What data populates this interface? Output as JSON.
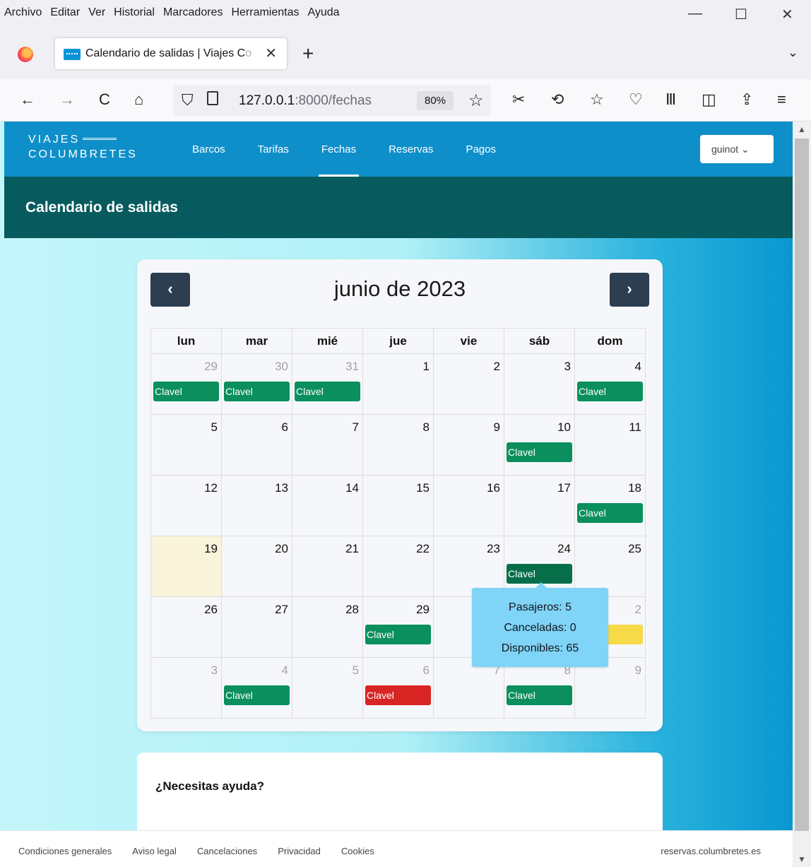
{
  "menubar": {
    "items": [
      "Archivo",
      "Editar",
      "Ver",
      "Historial",
      "Marcadores",
      "Herramientas",
      "Ayuda"
    ],
    "window_controls": [
      "—",
      "☐",
      "✕"
    ]
  },
  "tab": {
    "title": "Calendario de salidas | Viajes C",
    "title_fade": "o",
    "close": "✕",
    "new_tab": "+",
    "list_all": "⌄"
  },
  "navbar": {
    "back": "←",
    "forward": "→",
    "reload": "C",
    "home": "⌂",
    "url_host": "127.0.0.1",
    "url_rest": ":8000/fechas",
    "zoom": "80%",
    "bookmark_star": "☆",
    "toolbar_icons": [
      "screenshot-icon",
      "history-icon",
      "extension-star-icon",
      "pocket-icon",
      "library-icon",
      "sidebar-icon",
      "share-icon",
      "menu-icon"
    ],
    "toolbar_glyphs": [
      "✂",
      "⟲",
      "☆",
      "♡",
      "Ⅲ",
      "◫",
      "⇪",
      "≡"
    ]
  },
  "site": {
    "logo_line1": "VIAJES",
    "logo_line2": "COLUMBRETES",
    "nav": [
      "Barcos",
      "Tarifas",
      "Fechas",
      "Reservas",
      "Pagos"
    ],
    "active_nav": "Fechas",
    "user": "guinot ⌄",
    "page_title": "Calendario de salidas"
  },
  "calendar": {
    "prev": "‹",
    "next": "›",
    "month_title": "junio de 2023",
    "weekdays": [
      "lun",
      "mar",
      "mié",
      "jue",
      "vie",
      "sáb",
      "dom"
    ],
    "weeks": [
      [
        {
          "day": "29",
          "other": true,
          "event": "Clavel",
          "status": "green"
        },
        {
          "day": "30",
          "other": true,
          "event": "Clavel",
          "status": "green"
        },
        {
          "day": "31",
          "other": true,
          "event": "Clavel",
          "status": "green"
        },
        {
          "day": "1",
          "other": false,
          "event": "",
          "status": ""
        },
        {
          "day": "2",
          "other": false,
          "event": "",
          "status": ""
        },
        {
          "day": "3",
          "other": false,
          "event": "",
          "status": ""
        },
        {
          "day": "4",
          "other": false,
          "event": "Clavel",
          "status": "green"
        }
      ],
      [
        {
          "day": "5",
          "other": false,
          "event": "",
          "status": ""
        },
        {
          "day": "6",
          "other": false,
          "event": "",
          "status": ""
        },
        {
          "day": "7",
          "other": false,
          "event": "",
          "status": ""
        },
        {
          "day": "8",
          "other": false,
          "event": "",
          "status": ""
        },
        {
          "day": "9",
          "other": false,
          "event": "",
          "status": ""
        },
        {
          "day": "10",
          "other": false,
          "event": "Clavel",
          "status": "green"
        },
        {
          "day": "11",
          "other": false,
          "event": "",
          "status": ""
        }
      ],
      [
        {
          "day": "12",
          "other": false,
          "event": "",
          "status": ""
        },
        {
          "day": "13",
          "other": false,
          "event": "",
          "status": ""
        },
        {
          "day": "14",
          "other": false,
          "event": "",
          "status": ""
        },
        {
          "day": "15",
          "other": false,
          "event": "",
          "status": ""
        },
        {
          "day": "16",
          "other": false,
          "event": "",
          "status": ""
        },
        {
          "day": "17",
          "other": false,
          "event": "",
          "status": ""
        },
        {
          "day": "18",
          "other": false,
          "event": "Clavel",
          "status": "green"
        }
      ],
      [
        {
          "day": "19",
          "other": false,
          "today": true,
          "event": "",
          "status": ""
        },
        {
          "day": "20",
          "other": false,
          "event": "",
          "status": ""
        },
        {
          "day": "21",
          "other": false,
          "event": "",
          "status": ""
        },
        {
          "day": "22",
          "other": false,
          "event": "",
          "status": ""
        },
        {
          "day": "23",
          "other": false,
          "event": "",
          "status": ""
        },
        {
          "day": "24",
          "other": false,
          "event": "Clavel",
          "status": "darkgreen"
        },
        {
          "day": "25",
          "other": false,
          "event": "",
          "status": ""
        }
      ],
      [
        {
          "day": "26",
          "other": false,
          "event": "",
          "status": ""
        },
        {
          "day": "27",
          "other": false,
          "event": "",
          "status": ""
        },
        {
          "day": "28",
          "other": false,
          "event": "",
          "status": ""
        },
        {
          "day": "29",
          "other": false,
          "event": "Clavel",
          "status": "green"
        },
        {
          "day": "",
          "other": false,
          "event": "",
          "status": ""
        },
        {
          "day": "",
          "other": false,
          "event": "",
          "status": ""
        },
        {
          "day": "2",
          "other": true,
          "event": "l",
          "status": "yellow"
        }
      ],
      [
        {
          "day": "3",
          "other": true,
          "event": "",
          "status": ""
        },
        {
          "day": "4",
          "other": true,
          "event": "Clavel",
          "status": "green"
        },
        {
          "day": "5",
          "other": true,
          "event": "",
          "status": ""
        },
        {
          "day": "6",
          "other": true,
          "event": "Clavel",
          "status": "red"
        },
        {
          "day": "7",
          "other": true,
          "event": "",
          "status": ""
        },
        {
          "day": "8",
          "other": true,
          "event": "Clavel",
          "status": "green"
        },
        {
          "day": "9",
          "other": true,
          "event": "",
          "status": ""
        }
      ]
    ],
    "colors": {
      "green": "#0b8f5e",
      "darkgreen": "#076e4a",
      "red": "#d92424",
      "yellow": "#f6da4a"
    }
  },
  "tooltip": {
    "pasajeros": "Pasajeros: 5",
    "canceladas": "Canceladas: 0",
    "disponibles": "Disponibles: 65"
  },
  "help": {
    "title": "¿Necesitas ayuda?"
  },
  "footer": {
    "links": [
      "Condiciones generales",
      "Aviso legal",
      "Cancelaciones",
      "Privacidad",
      "Cookies"
    ],
    "site": "reservas.columbretes.es"
  }
}
